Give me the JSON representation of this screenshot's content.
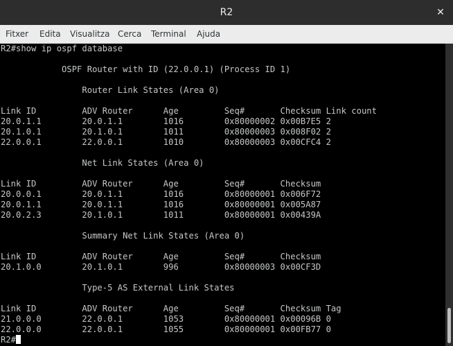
{
  "window": {
    "title": "R2",
    "close_glyph": "✕"
  },
  "menu": [
    "Fitxer",
    "Edita",
    "Visualitza",
    "Cerca",
    "Terminal",
    "Ajuda"
  ],
  "terminal": {
    "lines": [
      "R2#show ip ospf database",
      "",
      "            OSPF Router with ID (22.0.0.1) (Process ID 1)",
      "",
      "                Router Link States (Area 0)",
      "",
      "Link ID         ADV Router      Age         Seq#       Checksum Link count",
      "20.0.1.1        20.0.1.1        1016        0x80000002 0x00B7E5 2",
      "20.1.0.1        20.1.0.1        1011        0x80000003 0x008F02 2",
      "22.0.0.1        22.0.0.1        1010        0x80000003 0x00CFC4 2",
      "",
      "                Net Link States (Area 0)",
      "",
      "Link ID         ADV Router      Age         Seq#       Checksum",
      "20.0.0.1        20.0.1.1        1016        0x80000001 0x006F72",
      "20.0.1.1        20.0.1.1        1016        0x80000001 0x005A87",
      "20.0.2.3        20.1.0.1        1011        0x80000001 0x00439A",
      "",
      "                Summary Net Link States (Area 0)",
      "",
      "Link ID         ADV Router      Age         Seq#       Checksum",
      "20.1.0.0        20.1.0.1        996         0x80000003 0x00CF3D",
      "",
      "                Type-5 AS External Link States",
      "",
      "Link ID         ADV Router      Age         Seq#       Checksum Tag",
      "21.0.0.0        22.0.0.1        1053        0x80000001 0x00096B 0",
      "22.0.0.0        22.0.0.1        1055        0x80000001 0x00FB77 0"
    ],
    "prompt": "R2#"
  },
  "scrollbar": {
    "thumb_fraction": 0.12,
    "position": "bottom"
  },
  "colors": {
    "titlebar": "#2d2d2d",
    "menubar": "#ececec",
    "terminal_bg": "#000000",
    "terminal_fg": "#c5c8c6",
    "cursor": "#ffffff"
  }
}
